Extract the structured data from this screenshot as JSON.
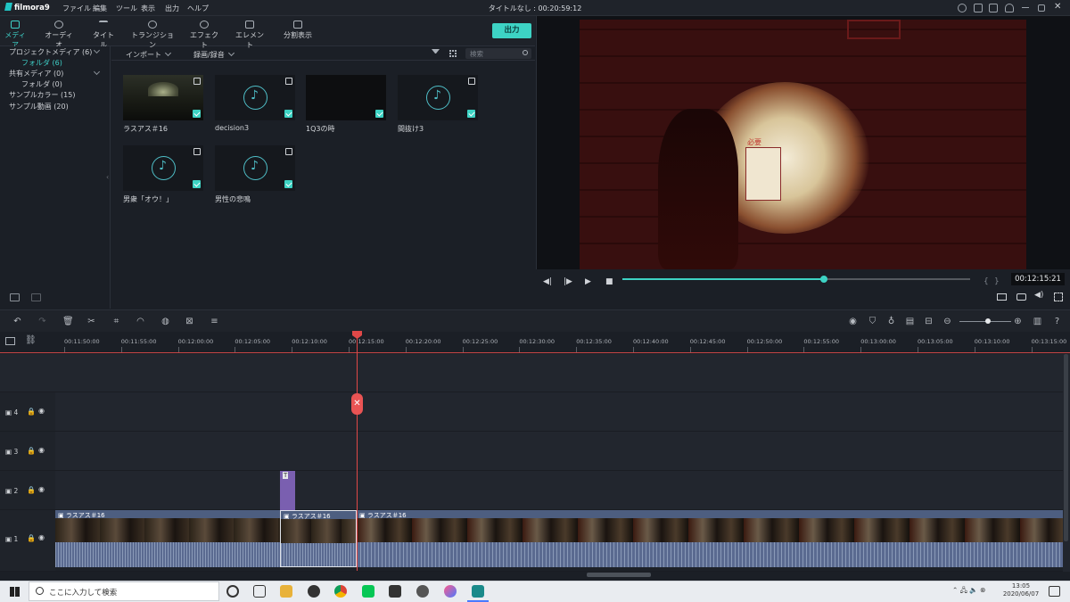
{
  "app": {
    "name": "filmora9",
    "window_title": "タイトルなし : 00:20:59:12"
  },
  "menu": [
    "ファイル",
    "編集",
    "ツール",
    "表示",
    "出力",
    "ヘルプ"
  ],
  "tabs": [
    {
      "label": "メディア",
      "icon": "folder-icon",
      "active": true
    },
    {
      "label": "オーディオ",
      "icon": "music-note-icon"
    },
    {
      "label": "タイトル",
      "icon": "text-icon"
    },
    {
      "label": "トランジション",
      "icon": "transition-icon"
    },
    {
      "label": "エフェクト",
      "icon": "effects-icon"
    },
    {
      "label": "エレメント",
      "icon": "elements-icon"
    },
    {
      "label": "分割表示",
      "icon": "split-screen-icon"
    }
  ],
  "export_label": "出力",
  "sidebar": {
    "items": [
      {
        "label": "プロジェクトメディア (6)",
        "expandable": true
      },
      {
        "label": "フォルダ (6)",
        "selected": true
      },
      {
        "label": "共有メディア (0)",
        "expandable": true
      },
      {
        "label": "フォルダ (0)"
      },
      {
        "label": "サンプルカラー (15)"
      },
      {
        "label": "サンプル動画 (20)"
      }
    ]
  },
  "media_toolbar": {
    "import": "インポート",
    "record": "録画/録音",
    "search_placeholder": "検索"
  },
  "media": [
    {
      "name": "ラスアス＃16",
      "type": "video"
    },
    {
      "name": "decision3",
      "type": "audio"
    },
    {
      "name": "1Q3の時",
      "type": "video-dark"
    },
    {
      "name": "間抜け3",
      "type": "audio"
    },
    {
      "name": "男衆「オウ！」",
      "type": "audio"
    },
    {
      "name": "男性の悲鳴",
      "type": "audio"
    }
  ],
  "preview": {
    "timecode": "00:12:15:21",
    "progress": 0.58,
    "video_overlay_text": "必要"
  },
  "ruler_ticks": [
    "00:11:50:00",
    "00:11:55:00",
    "00:12:00:00",
    "00:12:05:00",
    "00:12:10:00",
    "00:12:15:00",
    "00:12:20:00",
    "00:12:25:00",
    "00:12:30:00",
    "00:12:35:00",
    "00:12:40:00",
    "00:12:45:00",
    "00:12:50:00",
    "00:12:55:00",
    "00:13:00:00",
    "00:13:05:00",
    "00:13:10:00",
    "00:13:15:00"
  ],
  "tracks": [
    {
      "label": "4"
    },
    {
      "label": "3"
    },
    {
      "label": "2"
    },
    {
      "label": "1"
    }
  ],
  "clips": {
    "track1": [
      "ラスアス＃16",
      "ラスアス＃16",
      "ラスアス＃16"
    ],
    "title_clip": "T"
  },
  "playhead_marker": "✕",
  "taskbar": {
    "search_placeholder": "ここに入力して検索",
    "time": "13:05",
    "date": "2020/06/07"
  },
  "colors": {
    "accent": "#3dd3c4",
    "playhead": "#e04848",
    "title_clip": "#7a5fb0"
  }
}
